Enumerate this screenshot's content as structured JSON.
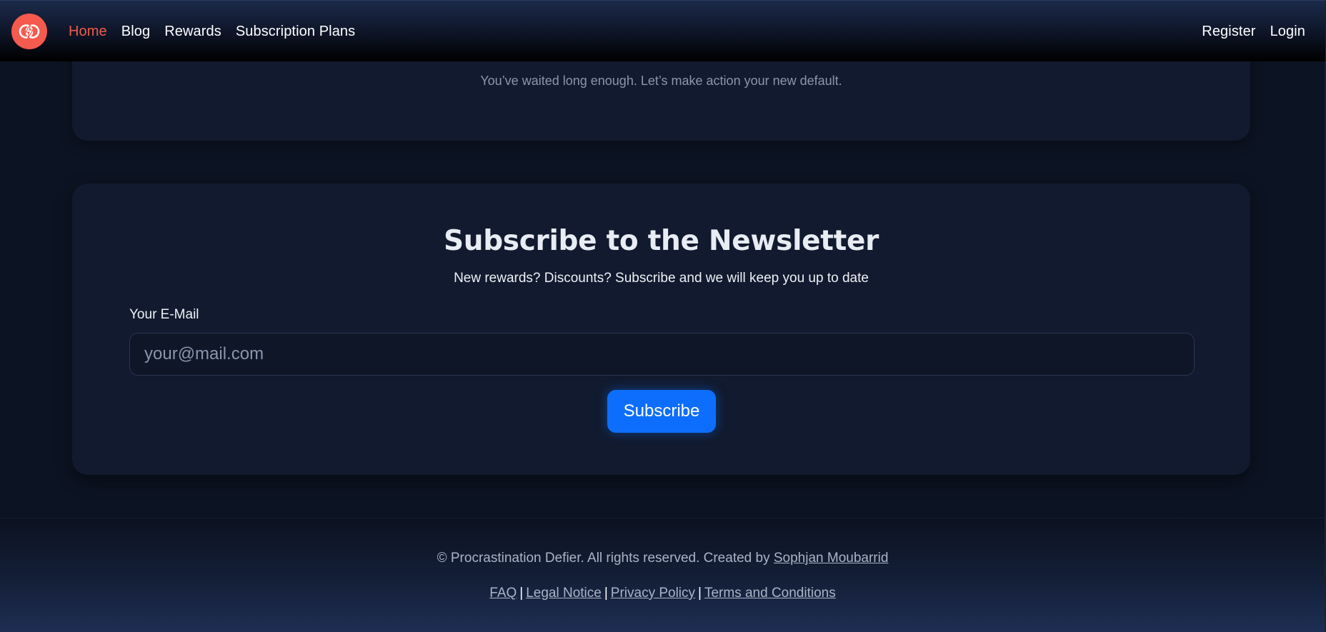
{
  "nav": {
    "logo_icon": "lightning-bolt-icon",
    "links": [
      {
        "label": "Home",
        "active": true
      },
      {
        "label": "Blog",
        "active": false
      },
      {
        "label": "Rewards",
        "active": false
      },
      {
        "label": "Subscription Plans",
        "active": false
      }
    ],
    "register_label": "Register",
    "login_label": "Login"
  },
  "hero_card": {
    "tagline": "You’ve waited long enough. Let’s make action your new default."
  },
  "newsletter": {
    "title": "Subscribe to the Newsletter",
    "subtitle": "New rewards? Discounts? Subscribe and we will keep you up to date",
    "email_label": "Your E-Mail",
    "email_placeholder": "your@mail.com",
    "email_value": "",
    "button_label": "Subscribe"
  },
  "footer": {
    "copyright_prefix": "© Procrastination Defier. All rights reserved. Created by",
    "author_link": "Sophjan Moubarrid",
    "links": [
      "FAQ",
      "Legal Notice",
      "Privacy Policy",
      "Terms and Conditions"
    ],
    "separator": "|"
  },
  "colors": {
    "accent_red": "#f15a4a",
    "button_blue": "#0d6efd",
    "card_bg": "#111a2e",
    "page_bg": "#0c1322"
  }
}
